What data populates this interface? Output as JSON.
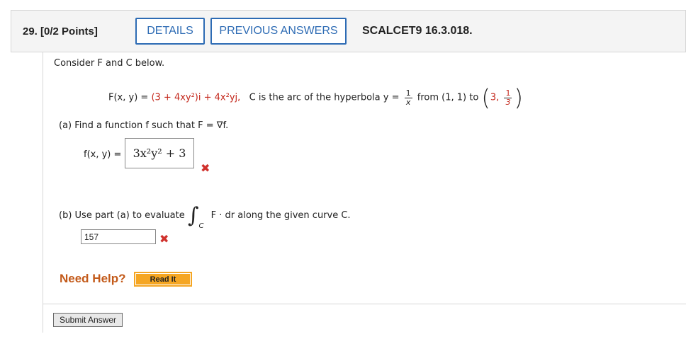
{
  "header": {
    "question_number": "29. [0/2 Points]",
    "details_label": "DETAILS",
    "previous_answers_label": "PREVIOUS ANSWERS",
    "section_ref": "SCALCET9 16.3.018."
  },
  "problem": {
    "intro": "Consider F and C below.",
    "vector_field_prefix": "F(x, y) = ",
    "vector_field_body": "(3 + 4xy²)i + 4x²yj,",
    "curve_desc_pre": "C is the arc of the hyperbola y =",
    "frac_num": "1",
    "frac_den": "x",
    "from_text": "from (1, 1) to",
    "point_x": "3,",
    "point_frac_num": "1",
    "point_frac_den": "3"
  },
  "part_a": {
    "prompt": "(a)   Find a function f such that F = ∇f.",
    "label": "f(x, y) =",
    "answer": "3x²y² + 3",
    "status": "✖"
  },
  "part_b": {
    "prompt": "(b)   Use part (a) to evaluate",
    "integral_symbol": "∫",
    "integral_subscript": "C",
    "integrand": "F · dr along the given curve C.",
    "answer": "157",
    "status": "✖"
  },
  "help": {
    "need_help": "Need Help?",
    "read_it": "Read It"
  },
  "submit_label": "Submit Answer",
  "colors": {
    "accent_blue": "#2d6bb4",
    "error_red": "#d0312d",
    "help_orange": "#c35a1a",
    "readit_orange": "#f5a623"
  }
}
